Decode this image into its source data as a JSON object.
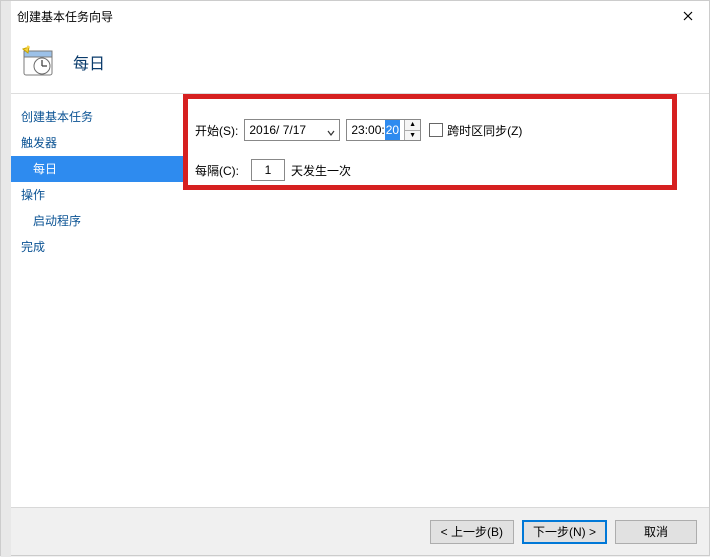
{
  "window": {
    "title": "创建基本任务向导"
  },
  "header": {
    "page_title": "每日"
  },
  "sidebar": {
    "items": [
      {
        "label": "创建基本任务",
        "indent": false,
        "selected": false
      },
      {
        "label": "触发器",
        "indent": false,
        "selected": false
      },
      {
        "label": "每日",
        "indent": true,
        "selected": true
      },
      {
        "label": "操作",
        "indent": false,
        "selected": false
      },
      {
        "label": "启动程序",
        "indent": true,
        "selected": false
      },
      {
        "label": "完成",
        "indent": false,
        "selected": false
      }
    ]
  },
  "form": {
    "start_label": "开始(S):",
    "date_value": "2016/ 7/17",
    "time_prefix": "23:00:",
    "time_selected": "20",
    "tz_sync_label": "跨时区同步(Z)",
    "tz_sync_checked": false,
    "interval_label": "每隔(C):",
    "interval_value": "1",
    "interval_suffix": "天发生一次"
  },
  "footer": {
    "back": "< 上一步(B)",
    "next": "下一步(N) >",
    "cancel": "取消"
  }
}
